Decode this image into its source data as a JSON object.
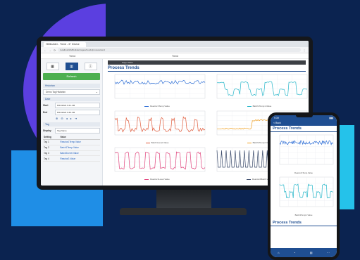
{
  "browser": {
    "tab_label": "HMIbuilder - Trend - 3+ Device",
    "url": "localhost/HMIbuilder/pages/trends/processtrend",
    "appbar_left": "Trend",
    "appbar_right": "Trend"
  },
  "sidebar": {
    "refresh_label": "Refresh",
    "section_history": "Historian",
    "historian_select": "Demo Tag Historian",
    "section_date": "Date",
    "start_label": "Start",
    "start_value": "8/21/2024 9:41 AM",
    "end_label": "End",
    "end_value": "8/21/2024 9:46 AM",
    "section_tag": "Tag",
    "display_label": "Display",
    "display_value": "Tag Name",
    "table_headers": [
      "Setting",
      "Value"
    ],
    "tags": [
      {
        "setting": "Tag 1",
        "value": "Reactor1Temp.Value"
      },
      {
        "setting": "Tag 2",
        "value": "Batch1Temp.Value"
      },
      {
        "setting": "Tag 3",
        "value": "Batch2Level.Value"
      },
      {
        "setting": "Tag 4",
        "value": "Reactor2.Value"
      }
    ]
  },
  "main": {
    "title": "Process Trends",
    "toolbar_text": "Page Width"
  },
  "charts": [
    {
      "legend": "Reactor1Temp.Value",
      "color": "#2f6fd6"
    },
    {
      "legend": "Batch1Temp1.Value",
      "color": "#25b6c9"
    },
    {
      "legend": "Batch1Level.Value",
      "color": "#e05a3a"
    },
    {
      "legend": "Batch2Temp2.Value",
      "color": "#f0a020"
    },
    {
      "legend": "Reactor1Level.Value",
      "color": "#e0407a"
    },
    {
      "legend": "Reactor2Batch.Value",
      "color": "#3a4a6a"
    }
  ],
  "phone": {
    "time": "9:39",
    "back_label": "< Back",
    "title": "Process Trends",
    "chart1_legend": "Reactor1Temp.Value",
    "chart2_legend": "Batch1Temp1.Value",
    "title2": "Process Trends"
  },
  "colors": {
    "background": "#0b2350",
    "accent": "#1f4e91",
    "green": "#4caf50"
  }
}
